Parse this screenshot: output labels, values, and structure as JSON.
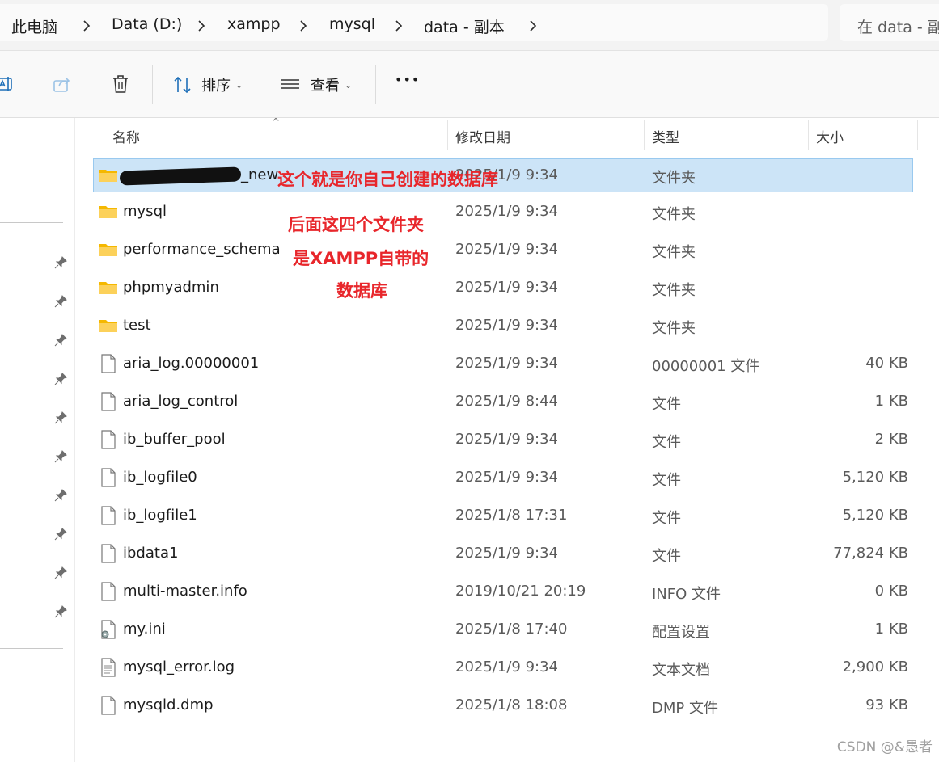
{
  "breadcrumb": {
    "items": [
      "此电脑",
      "Data (D:)",
      "xampp",
      "mysql",
      "data - 副本"
    ],
    "search_placeholder": "在 data - 副"
  },
  "toolbar": {
    "sort_label": "排序",
    "view_label": "查看",
    "more_label": "•••"
  },
  "columns": {
    "name": "名称",
    "date": "修改日期",
    "type": "类型",
    "size": "大小"
  },
  "files": [
    {
      "name": "_new",
      "date": "2025/1/9 9:34",
      "type": "文件夹",
      "size": "",
      "icon": "folder-icon",
      "selected": true
    },
    {
      "name": "mysql",
      "date": "2025/1/9 9:34",
      "type": "文件夹",
      "size": "",
      "icon": "folder-icon"
    },
    {
      "name": "performance_schema",
      "date": "2025/1/9 9:34",
      "type": "文件夹",
      "size": "",
      "icon": "folder-icon"
    },
    {
      "name": "phpmyadmin",
      "date": "2025/1/9 9:34",
      "type": "文件夹",
      "size": "",
      "icon": "folder-icon"
    },
    {
      "name": "test",
      "date": "2025/1/9 9:34",
      "type": "文件夹",
      "size": "",
      "icon": "folder-icon"
    },
    {
      "name": "aria_log.00000001",
      "date": "2025/1/9 9:34",
      "type": "00000001 文件",
      "size": "40 KB",
      "icon": "file-icon"
    },
    {
      "name": "aria_log_control",
      "date": "2025/1/9 8:44",
      "type": "文件",
      "size": "1 KB",
      "icon": "file-icon"
    },
    {
      "name": "ib_buffer_pool",
      "date": "2025/1/9 9:34",
      "type": "文件",
      "size": "2 KB",
      "icon": "file-icon"
    },
    {
      "name": "ib_logfile0",
      "date": "2025/1/9 9:34",
      "type": "文件",
      "size": "5,120 KB",
      "icon": "file-icon"
    },
    {
      "name": "ib_logfile1",
      "date": "2025/1/8 17:31",
      "type": "文件",
      "size": "5,120 KB",
      "icon": "file-icon"
    },
    {
      "name": "ibdata1",
      "date": "2025/1/9 9:34",
      "type": "文件",
      "size": "77,824 KB",
      "icon": "file-icon"
    },
    {
      "name": "multi-master.info",
      "date": "2019/10/21 20:19",
      "type": "INFO 文件",
      "size": "0 KB",
      "icon": "file-icon"
    },
    {
      "name": "my.ini",
      "date": "2025/1/8 17:40",
      "type": "配置设置",
      "size": "1 KB",
      "icon": "config-file-icon"
    },
    {
      "name": "mysql_error.log",
      "date": "2025/1/9 9:34",
      "type": "文本文档",
      "size": "2,900 KB",
      "icon": "text-file-icon"
    },
    {
      "name": "mysqld.dmp",
      "date": "2025/1/8 18:08",
      "type": "DMP 文件",
      "size": "93 KB",
      "icon": "file-icon"
    }
  ],
  "annotations": {
    "note1": "这个就是你自己创建的数据库",
    "note2_line1": "后面这四个文件夹",
    "note2_line2": "是XAMPP自带的",
    "note2_line3": "数据库"
  },
  "watermark": "CSDN @&愚者",
  "colors": {
    "selection": "#cce4f7",
    "annotation": "#e8262b",
    "folder": "#f8c34a"
  }
}
